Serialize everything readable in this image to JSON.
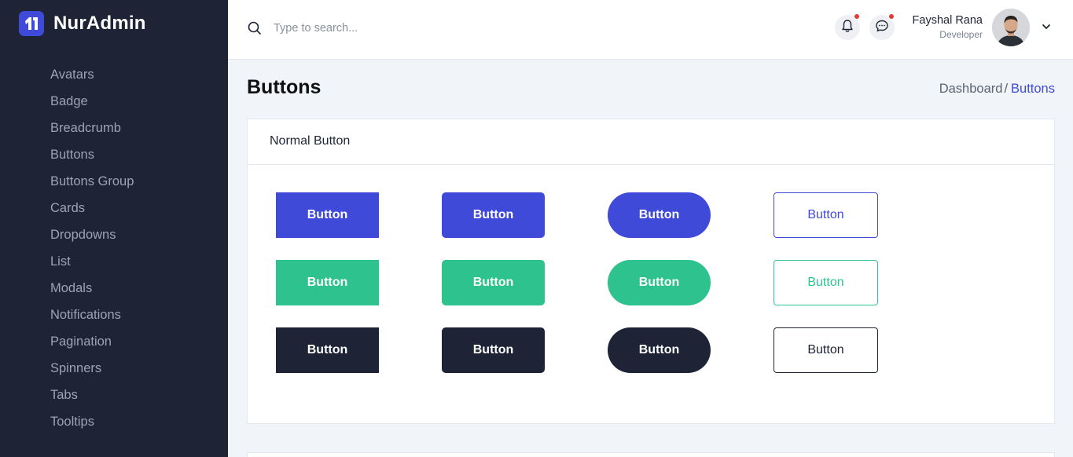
{
  "brand": {
    "name": "NurAdmin"
  },
  "sidebar": {
    "items": [
      {
        "label": "Avatars"
      },
      {
        "label": "Badge"
      },
      {
        "label": "Breadcrumb"
      },
      {
        "label": "Buttons"
      },
      {
        "label": "Buttons Group"
      },
      {
        "label": "Cards"
      },
      {
        "label": "Dropdowns"
      },
      {
        "label": "List"
      },
      {
        "label": "Modals"
      },
      {
        "label": "Notifications"
      },
      {
        "label": "Pagination"
      },
      {
        "label": "Spinners"
      },
      {
        "label": "Tabs"
      },
      {
        "label": "Tooltips"
      }
    ]
  },
  "header": {
    "search": {
      "placeholder": "Type to search...",
      "value": ""
    },
    "notifications_icon": "bell-icon",
    "messages_icon": "chat-icon",
    "user": {
      "name": "Fayshal Rana",
      "role": "Developer"
    }
  },
  "page": {
    "title": "Buttons",
    "breadcrumb": {
      "home": "Dashboard",
      "separator": "/",
      "current": "Buttons"
    }
  },
  "card": {
    "title": "Normal Button",
    "buttons": {
      "r1c1": "Button",
      "r1c2": "Button",
      "r1c3": "Button",
      "r1c4": "Button",
      "r2c1": "Button",
      "r2c2": "Button",
      "r2c3": "Button",
      "r2c4": "Button",
      "r3c1": "Button",
      "r3c2": "Button",
      "r3c3": "Button",
      "r3c4": "Button"
    }
  },
  "colors": {
    "primary": "#3f4ad8",
    "success": "#2ec38e",
    "dark": "#1e2435",
    "notification_dot": "#e53935"
  }
}
